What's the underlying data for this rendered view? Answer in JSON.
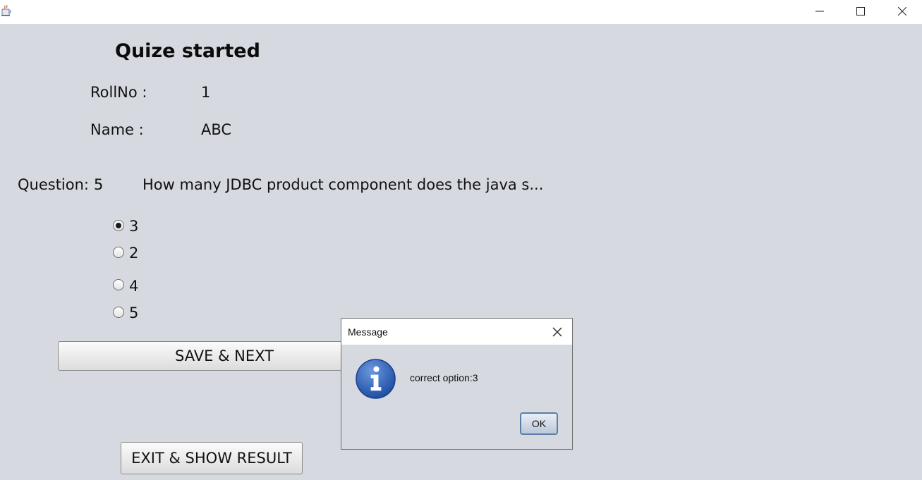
{
  "window": {
    "app_icon": "java-coffee-icon",
    "controls": [
      "minimize-icon",
      "maximize-icon",
      "close-icon"
    ]
  },
  "quiz": {
    "heading": "Quize started",
    "rollno_label": "RollNo :",
    "rollno_value": "1",
    "name_label": "Name :",
    "name_value": "ABC",
    "question_label": "Question:",
    "question_number": "5",
    "question_text": "How many JDBC product component does the java s...",
    "options": [
      {
        "label": "3",
        "selected": true
      },
      {
        "label": "2",
        "selected": false
      },
      {
        "label": "4",
        "selected": false
      },
      {
        "label": "5",
        "selected": false
      }
    ],
    "save_next_label": "SAVE & NEXT",
    "exit_label": "EXIT & SHOW RESULT"
  },
  "dialog": {
    "title": "Message",
    "icon": "info-icon",
    "message": "correct option:3",
    "ok_label": "OK"
  }
}
